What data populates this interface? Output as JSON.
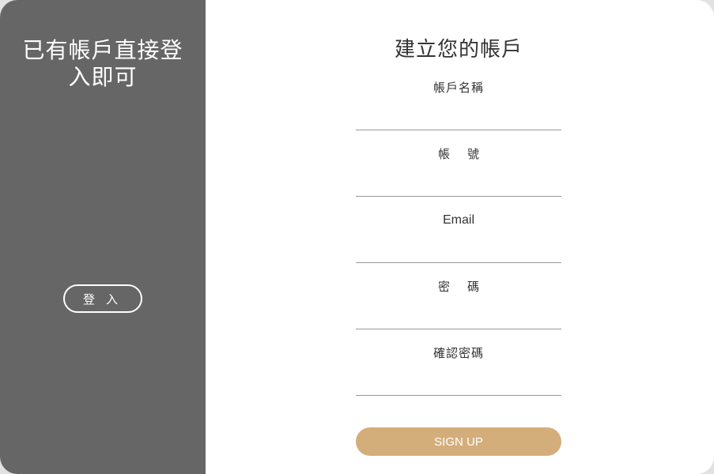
{
  "left_panel": {
    "title": "已有帳戶直接登入即可",
    "login_label": "登入"
  },
  "form": {
    "title": "建立您的帳戶",
    "fields": [
      {
        "label": "帳戶名稱",
        "value": "",
        "placeholder": ""
      },
      {
        "label": "帳號",
        "value": "",
        "placeholder": ""
      },
      {
        "label": "Email",
        "value": "",
        "placeholder": ""
      },
      {
        "label": "密碼",
        "value": "",
        "placeholder": ""
      },
      {
        "label": "確認密碼",
        "value": "",
        "placeholder": ""
      }
    ],
    "submit_label": "SIGN UP"
  },
  "colors": {
    "left_panel_bg": "#666666",
    "accent": "#d4ae7a",
    "underline": "#999999"
  }
}
